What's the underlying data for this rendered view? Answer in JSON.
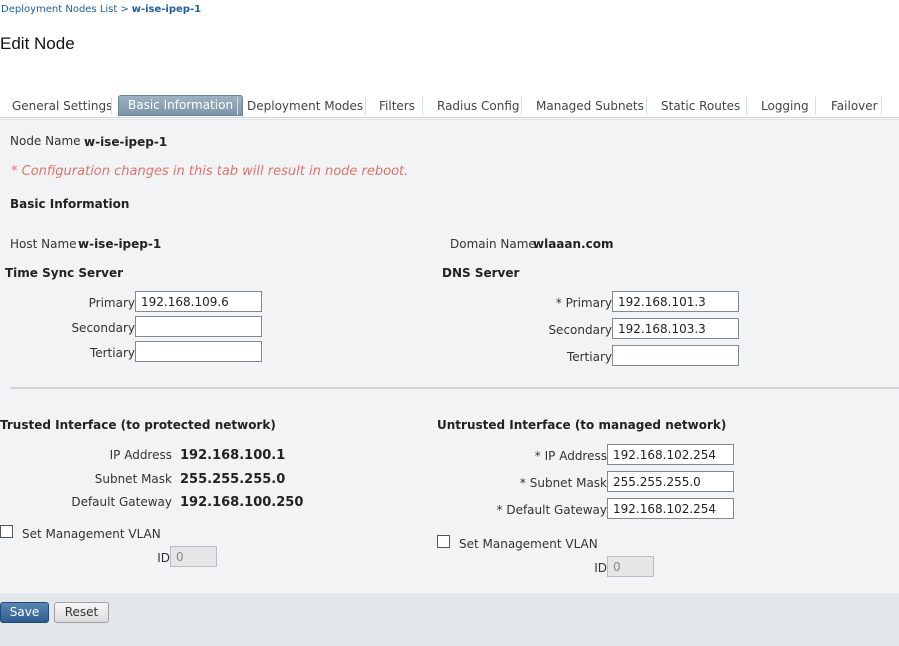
{
  "breadcrumb": {
    "parent": "Deployment Nodes List",
    "separator": ">",
    "current": "w-ise-ipep-1"
  },
  "page_title": "Edit Node",
  "tabs": [
    {
      "label": "General Settings",
      "active": false
    },
    {
      "label": "Basic Information",
      "active": true
    },
    {
      "label": "Deployment Modes",
      "active": false
    },
    {
      "label": "Filters",
      "active": false
    },
    {
      "label": "Radius Config",
      "active": false
    },
    {
      "label": "Managed Subnets",
      "active": false
    },
    {
      "label": "Static Routes",
      "active": false
    },
    {
      "label": "Logging",
      "active": false
    },
    {
      "label": "Failover",
      "active": false
    }
  ],
  "node": {
    "name_label": "Node Name",
    "name_value": "w-ise-ipep-1"
  },
  "warning": "* Configuration changes in this tab will result in node reboot.",
  "basic_info": {
    "heading": "Basic Information",
    "host_label": "Host Name",
    "host_value": "w-ise-ipep-1",
    "domain_label": "Domain Name",
    "domain_value": "wlaaan.com"
  },
  "time_sync": {
    "heading": "Time Sync Server",
    "primary_label": "Primary",
    "primary_value": "192.168.109.6",
    "secondary_label": "Secondary",
    "secondary_value": "",
    "tertiary_label": "Tertiary",
    "tertiary_value": ""
  },
  "dns": {
    "heading": "DNS Server",
    "primary_label": "* Primary",
    "primary_value": "192.168.101.3",
    "secondary_label": "Secondary",
    "secondary_value": "192.168.103.3",
    "tertiary_label": "Tertiary",
    "tertiary_value": ""
  },
  "trusted": {
    "heading": "Trusted Interface (to protected network)",
    "ip_label": "IP Address",
    "ip_value": "192.168.100.1",
    "mask_label": "Subnet Mask",
    "mask_value": "255.255.255.0",
    "gw_label": "Default Gateway",
    "gw_value": "192.168.100.250",
    "vlan_label": "Set Management VLAN",
    "vlan_checked": false,
    "id_label": "ID",
    "id_value": "0"
  },
  "untrusted": {
    "heading": "Untrusted Interface (to managed network)",
    "ip_label": "* IP Address",
    "ip_value": "192.168.102.254",
    "mask_label": "* Subnet Mask",
    "mask_value": "255.255.255.0",
    "gw_label": "* Default Gateway",
    "gw_value": "192.168.102.254",
    "vlan_label": "Set Management VLAN",
    "vlan_checked": false,
    "id_label": "ID",
    "id_value": "0"
  },
  "buttons": {
    "save": "Save",
    "reset": "Reset"
  },
  "colors": {
    "link": "#1f5f9e",
    "warning": "#e0746c",
    "active_tab": "#8aa0b4",
    "save_button": "#2f5c8f"
  }
}
